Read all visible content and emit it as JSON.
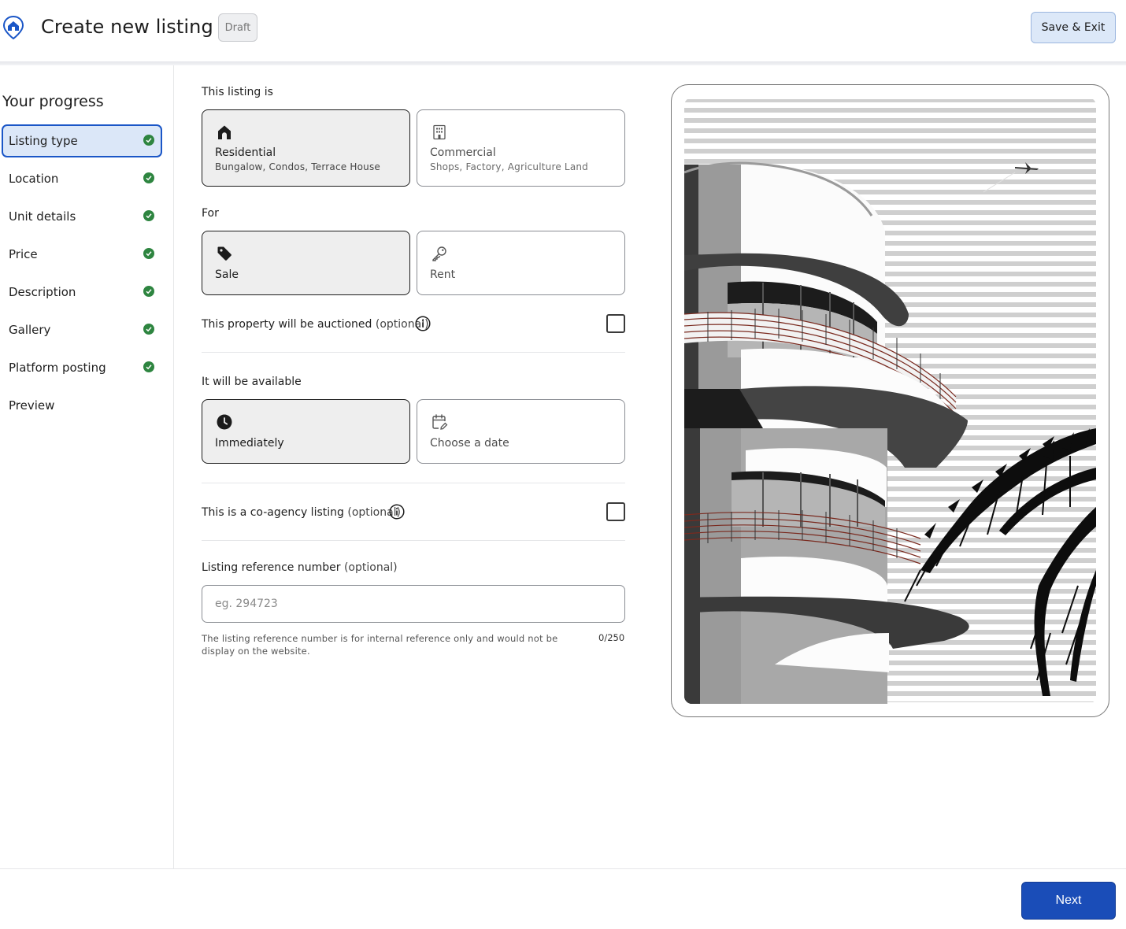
{
  "header": {
    "title": "Create new listing",
    "badge": "Draft",
    "save_exit": "Save & Exit"
  },
  "sidebar": {
    "title": "Your progress",
    "steps": [
      {
        "label": "Listing type",
        "done": true,
        "active": true
      },
      {
        "label": "Location",
        "done": true
      },
      {
        "label": "Unit details",
        "done": true
      },
      {
        "label": "Price",
        "done": true
      },
      {
        "label": "Description",
        "done": true
      },
      {
        "label": "Gallery",
        "done": true
      },
      {
        "label": "Platform posting",
        "done": true
      },
      {
        "label": "Preview",
        "done": false
      }
    ]
  },
  "form": {
    "listing_is": {
      "label": "This listing is",
      "options": [
        {
          "title": "Residential",
          "subtitle": "Bungalow, Condos, Terrace House",
          "selected": true
        },
        {
          "title": "Commercial",
          "subtitle": "Shops, Factory, Agriculture Land",
          "selected": false
        }
      ]
    },
    "for": {
      "label": "For",
      "options": [
        {
          "title": "Sale",
          "selected": true
        },
        {
          "title": "Rent",
          "selected": false
        }
      ]
    },
    "auction": {
      "label": "This property will be auctioned",
      "optional": "(optional)",
      "checked": false
    },
    "availability": {
      "label": "It will be available",
      "options": [
        {
          "title": "Immediately",
          "selected": true
        },
        {
          "title": "Choose a date",
          "selected": false
        }
      ]
    },
    "coagency": {
      "label": "This is a co-agency listing",
      "optional": "(optional)",
      "checked": false
    },
    "reference": {
      "label": "Listing reference number",
      "optional": "(optional)",
      "placeholder": "eg. 294723",
      "value": "",
      "helper": "The listing reference number is for internal reference only and would not be display on the website.",
      "counter": "0/250"
    }
  },
  "footer": {
    "next": "Next"
  },
  "colors": {
    "accent": "#1a4db8",
    "active_step_bg": "#dbe7f8",
    "check_green": "#2e8540",
    "selected_card_bg": "#eeeeee"
  }
}
